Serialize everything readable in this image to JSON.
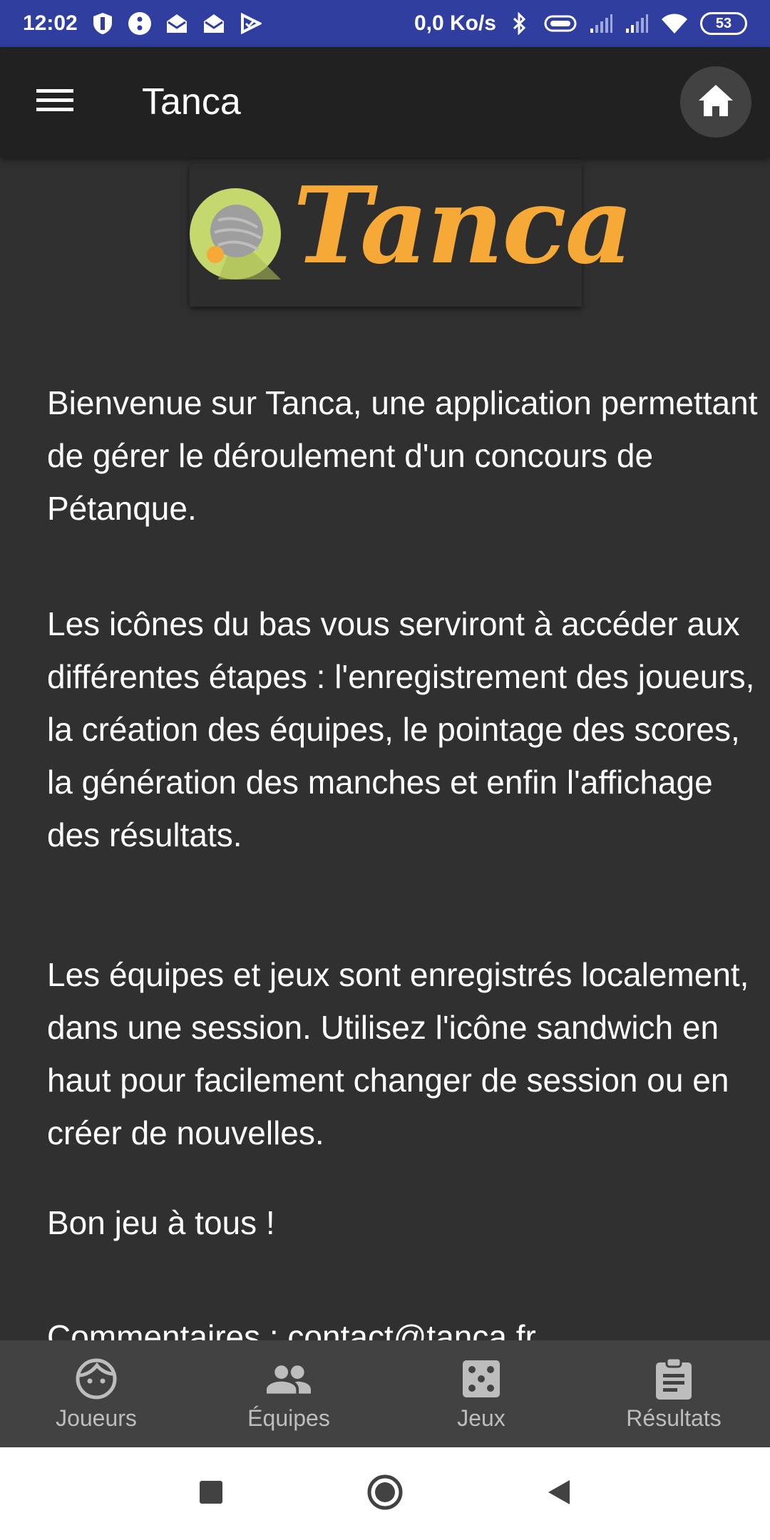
{
  "status_bar": {
    "time": "12:02",
    "network_speed": "0,0 Ko/s",
    "battery": "53",
    "icons": [
      "shield-icon",
      "record-icon",
      "mail-open-icon",
      "mail-open-icon",
      "play-check-icon",
      "bluetooth-icon",
      "vibrate-icon",
      "signal-icon",
      "signal-icon",
      "wifi-icon",
      "battery-icon"
    ]
  },
  "app_bar": {
    "title": "Tanca",
    "menu_icon": "menu-icon",
    "home_icon": "home-icon",
    "background": "#212121"
  },
  "logo": {
    "text": "Tanca",
    "color": "#f7a937"
  },
  "content": {
    "paragraph1": "Bienvenue sur Tanca, une application permettant de gérer le déroulement d'un concours de Pétanque.",
    "paragraph2": "Les icônes du bas vous serviront à accéder aux différentes étapes : l'enregistrement des joueurs, la création des équipes, le pointage des scores, la génération des manches et enfin l'affichage des résultats.",
    "paragraph3": "Les équipes et jeux sont enregistrés localement, dans une session. Utilisez l'icône sandwich en haut pour facilement changer de session ou en créer de nouvelles.",
    "paragraph4": "Bon jeu à tous !",
    "paragraph5": "Commentaires : contact@tanca.fr"
  },
  "bottom_nav": {
    "items": [
      {
        "label": "Joueurs",
        "icon": "face-icon"
      },
      {
        "label": "Équipes",
        "icon": "people-icon"
      },
      {
        "label": "Jeux",
        "icon": "dice-icon"
      },
      {
        "label": "Résultats",
        "icon": "clipboard-icon"
      }
    ]
  },
  "colors": {
    "status_bar": "#303f9f",
    "background": "#303030",
    "accent": "#f7a937",
    "nav_background": "#424242"
  }
}
